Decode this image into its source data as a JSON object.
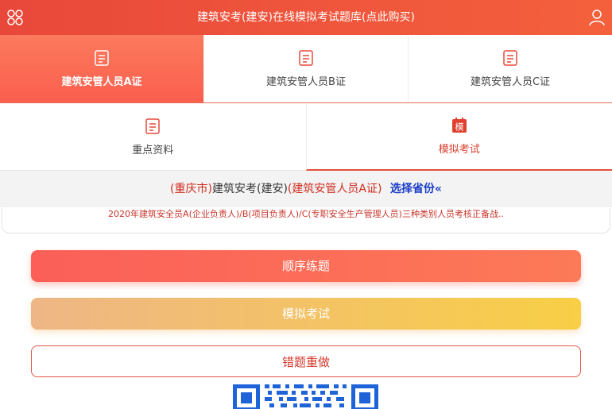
{
  "header": {
    "title": "建筑安考(建安)在线模拟考试题库(点此购买)"
  },
  "cert_tabs": [
    {
      "label": "建筑安管人员A证",
      "active": true
    },
    {
      "label": "建筑安管人员B证",
      "active": false
    },
    {
      "label": "建筑安管人员C证",
      "active": false
    }
  ],
  "section_tabs": [
    {
      "label": "重点资料",
      "active": false
    },
    {
      "label": "模拟考试",
      "active": true,
      "icon_text": "模"
    }
  ],
  "region_bar": {
    "open_paren": "(",
    "city": "重庆市",
    "close_paren": ")",
    "exam": "建筑安考(建安)",
    "cert_full": "(建筑安管人员A证)",
    "select_province": "选择省份«"
  },
  "notice": "2020年建筑安全员A(企业负责人)/B(项目负责人)/C(专职安全生产管理人员)三种类别人员考核正备战..",
  "buttons": {
    "sequential": "顺序练题",
    "mock": "模拟考试",
    "wrong": "错题重做"
  },
  "colors": {
    "brand": "#e8483a",
    "active_tab": "#fb6a52",
    "link_blue": "#1a3cc8",
    "qr_blue": "#1f63d8"
  }
}
